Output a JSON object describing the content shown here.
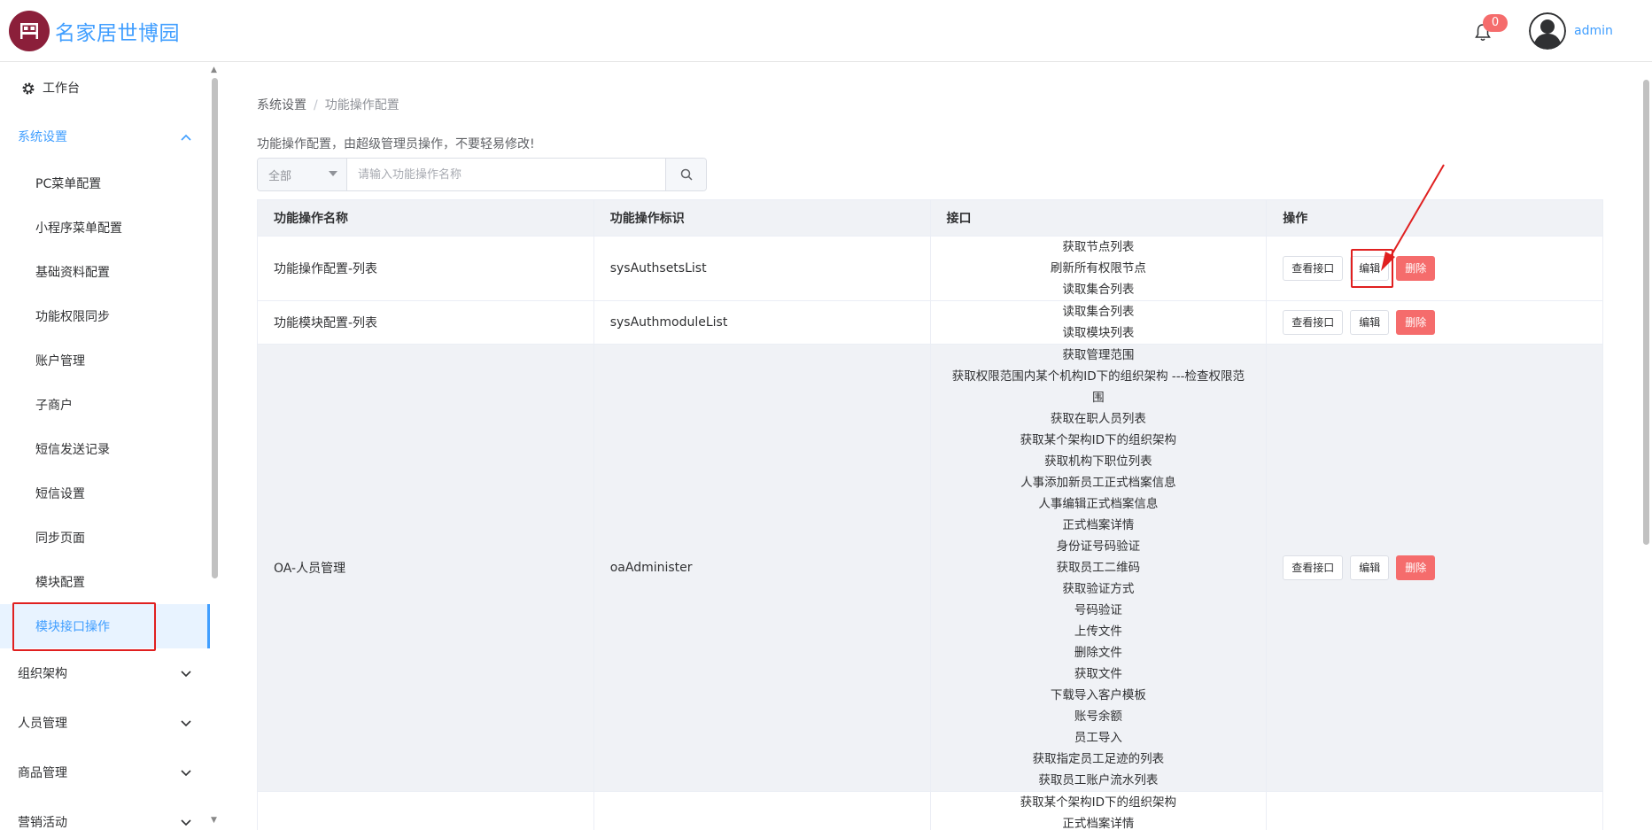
{
  "header": {
    "brand": "名家居世博园",
    "notification_count": "0",
    "username": "admin"
  },
  "sidebar": {
    "items": [
      {
        "label": "工作台",
        "icon": "gear-icon"
      },
      {
        "label": "系统设置",
        "expanded": true
      },
      {
        "label": "PC菜单配置"
      },
      {
        "label": "小程序菜单配置"
      },
      {
        "label": "基础资料配置"
      },
      {
        "label": "功能权限同步"
      },
      {
        "label": "账户管理"
      },
      {
        "label": "子商户"
      },
      {
        "label": "短信发送记录"
      },
      {
        "label": "短信设置"
      },
      {
        "label": "同步页面"
      },
      {
        "label": "模块配置"
      },
      {
        "label": "模块接口操作",
        "active": true
      },
      {
        "label": "组织架构"
      },
      {
        "label": "人员管理"
      },
      {
        "label": "商品管理"
      },
      {
        "label": "营销活动"
      }
    ]
  },
  "breadcrumb": {
    "parent": "系统设置",
    "current": "功能操作配置"
  },
  "note": "功能操作配置，由超级管理员操作，不要轻易修改!",
  "search": {
    "select_value": "全部",
    "placeholder": "请输入功能操作名称"
  },
  "table": {
    "headers": [
      "功能操作名称",
      "功能操作标识",
      "接口",
      "操作"
    ],
    "rows": [
      {
        "name": "功能操作配置-列表",
        "key": "sysAuthsetsList",
        "interfaces": [
          "获取节点列表",
          "刷新所有权限节点",
          "读取集合列表"
        ]
      },
      {
        "name": "功能模块配置-列表",
        "key": "sysAuthmoduleList",
        "interfaces": [
          "读取集合列表",
          "读取模块列表"
        ]
      },
      {
        "name": "OA-人员管理",
        "key": "oaAdminister",
        "interfaces": [
          "获取管理范围",
          "获取权限范围内某个机构ID下的组织架构 ---检查权限范围",
          "获取在职人员列表",
          "获取某个架构ID下的组织架构",
          "获取机构下职位列表",
          "人事添加新员工正式档案信息",
          "人事编辑正式档案信息",
          "正式档案详情",
          "身份证号码验证",
          "获取员工二维码",
          "获取验证方式",
          "号码验证",
          "上传文件",
          "删除文件",
          "获取文件",
          "下载导入客户模板",
          "账号余额",
          "员工导入",
          "获取指定员工足迹的列表",
          "获取员工账户流水列表"
        ]
      },
      {
        "name": "",
        "key": "",
        "interfaces": [
          "获取某个架构ID下的组织架构",
          "正式档案详情"
        ]
      }
    ],
    "actions": {
      "view": "查看接口",
      "edit": "编辑",
      "delete": "删除"
    }
  },
  "colors": {
    "accent": "#409eff",
    "danger": "#f56c6c",
    "annotation": "#e02020",
    "logo_bg": "#8b1f3a"
  }
}
